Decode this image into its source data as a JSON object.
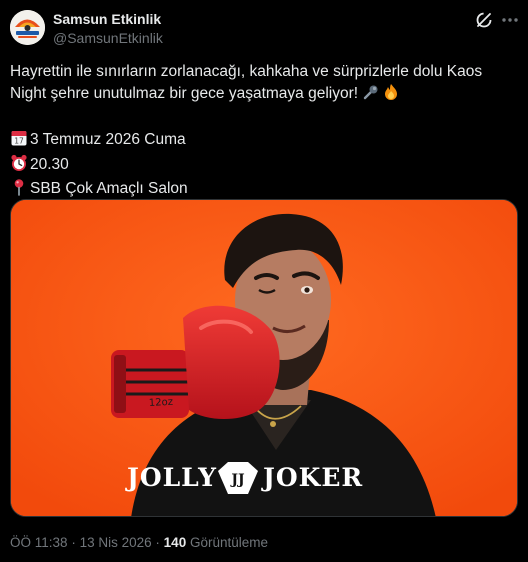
{
  "author": {
    "display_name": "Samsun Etkinlik",
    "handle": "@SamsunEtkinlik",
    "avatar_text": "SAMSUN etkinlik"
  },
  "tweet": {
    "line1": "Hayrettin ile sınırların zorlanacağı, kahkaha ve sürprizlerle dolu Kaos",
    "line2": "Night şehre unutulmaz bir gece yaşatmaya geliyor!",
    "date_line": "3 Temmuz 2026 Cuma",
    "time_line": "20.30",
    "venue_line": "SBB Çok Amaçlı Salon",
    "icons": [
      "microphone-icon",
      "fire-icon",
      "calendar-icon",
      "alarm-clock-icon",
      "pin-icon"
    ]
  },
  "media": {
    "brand_left": "JOLLY",
    "brand_monogram": "JJ",
    "brand_right": "JOKER",
    "glove_text": "12oz",
    "background_color": "#ff5a14"
  },
  "meta": {
    "time": "ÖÖ 11:38",
    "separator": "·",
    "date": "13 Nis 2026",
    "views": "140",
    "views_label": "Görüntüleme"
  },
  "colors": {
    "background": "#000000",
    "text": "#e7e9ea",
    "secondary": "#71767b"
  }
}
